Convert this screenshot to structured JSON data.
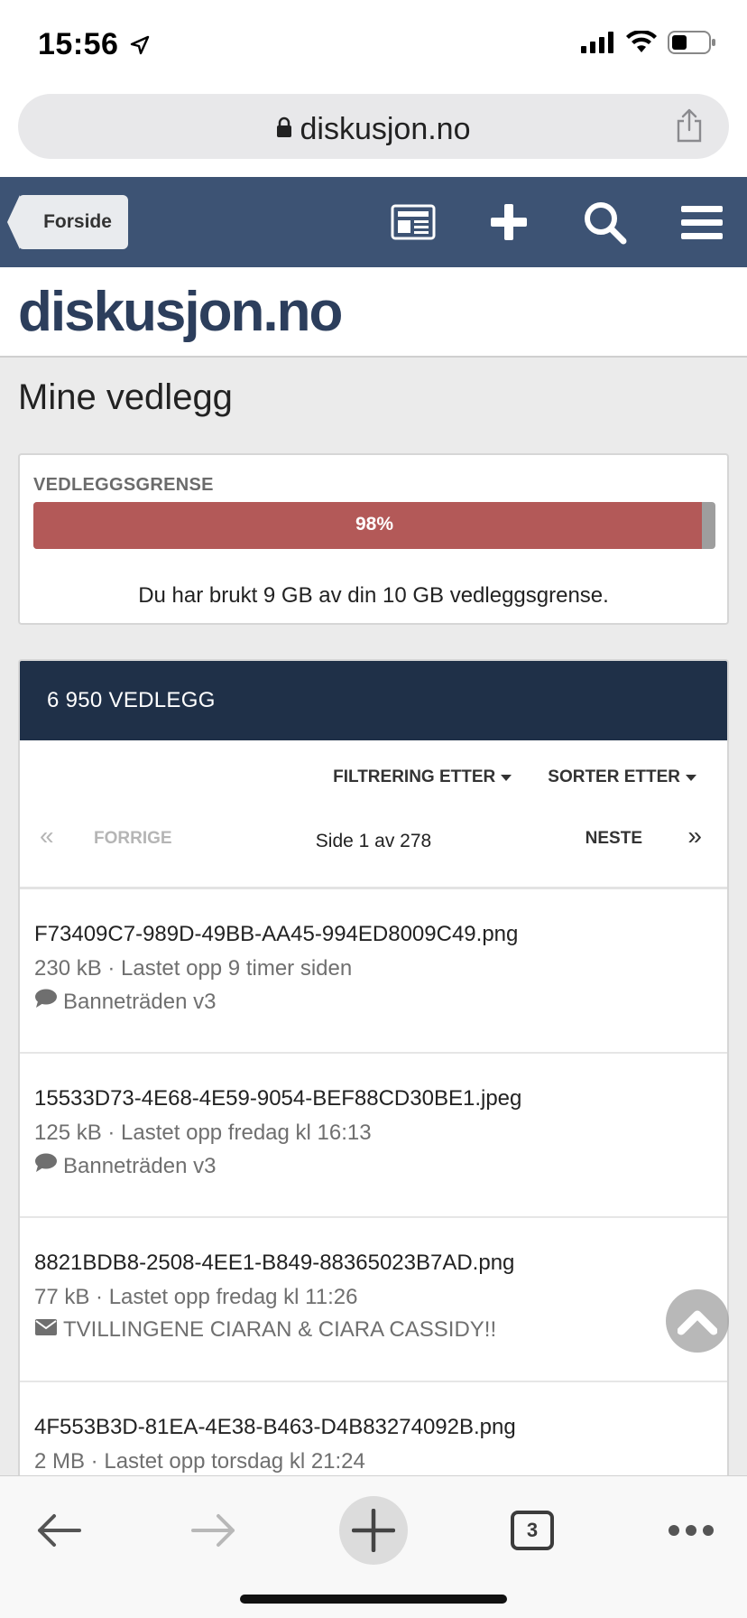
{
  "status": {
    "time": "15:56"
  },
  "browser": {
    "url": "diskusjon.no",
    "tab_count": "3"
  },
  "nav": {
    "back_label": "Forside"
  },
  "site": {
    "logo": "diskusjon.no"
  },
  "page": {
    "title": "Mine vedlegg"
  },
  "quota": {
    "label": "VEDLEGGSGRENSE",
    "percent_text": "98%",
    "percent_value": 0.98,
    "description": "Du har brukt 9 GB av din 10 GB vedleggsgrense."
  },
  "attachments": {
    "count_title": "6 950 VEDLEGG",
    "filter_label": "FILTRERING ETTER",
    "sort_label": "SORTER ETTER",
    "pager": {
      "first": "«",
      "prev": "FORRIGE",
      "info": "Side 1 av 278",
      "next": "NESTE",
      "last": "»"
    },
    "items": [
      {
        "name": "F73409C7-989D-49BB-AA45-994ED8009C49.png",
        "meta": "230 kB · Lastet opp 9 timer siden",
        "ref_icon": "comment-icon",
        "ref": "Banneträden v3"
      },
      {
        "name": "15533D73-4E68-4E59-9054-BEF88CD30BE1.jpeg",
        "meta": "125 kB · Lastet opp fredag kl 16:13",
        "ref_icon": "comment-icon",
        "ref": "Banneträden v3"
      },
      {
        "name": "8821BDB8-2508-4EE1-B849-88365023B7AD.png",
        "meta": "77 kB · Lastet opp fredag kl 11:26",
        "ref_icon": "envelope-icon",
        "ref": "TVILLINGENE CIARAN & CIARA CASSIDY!!"
      },
      {
        "name": "4F553B3D-81EA-4E38-B463-D4B83274092B.png",
        "meta": "2 MB · Lastet opp torsdag kl 21:24",
        "ref_icon": "",
        "ref": ""
      }
    ]
  },
  "colors": {
    "nav_bg": "#3d5374",
    "panel_head": "#1f3048",
    "progress_fill": "#b35958"
  }
}
